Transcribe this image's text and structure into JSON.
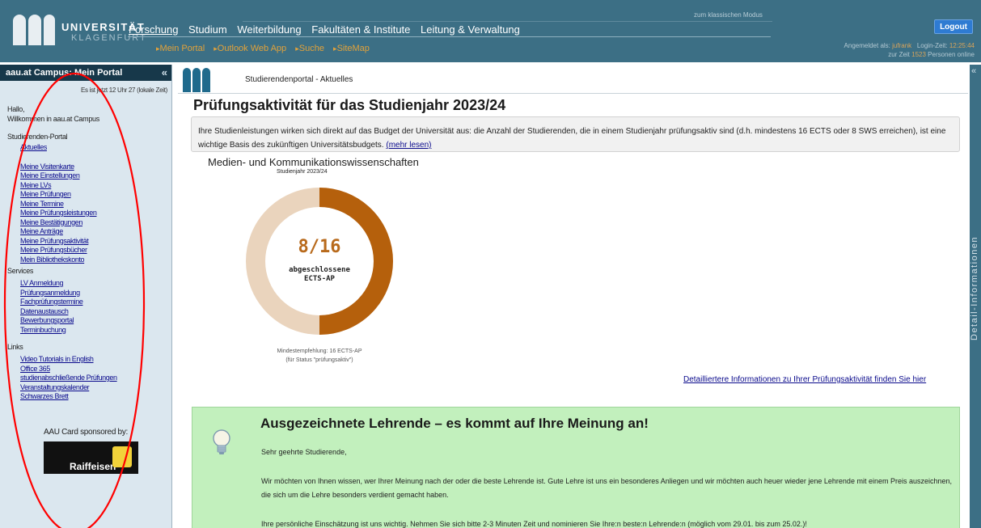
{
  "header": {
    "logo_university": "UNIVERSITÄT",
    "logo_city": "KLAGENFURT",
    "main_nav": [
      "Forschung",
      "Studium",
      "Weiterbildung",
      "Fakultäten & Institute",
      "Leitung & Verwaltung"
    ],
    "sub_nav": [
      "Mein Portal",
      "Outlook Web App",
      "Suche",
      "SiteMap"
    ],
    "classic_mode": "zum klassischen Modus",
    "logout": "Logout",
    "login_label": "Angemeldet als:",
    "login_user": "jufrank",
    "login_time_label": "Login-Zeit:",
    "login_time": "12:25:44",
    "online_prefix": "zur Zeit",
    "online_count": "1523",
    "online_suffix": "Personen online"
  },
  "sidebar": {
    "title": "aau.at Campus: Mein Portal",
    "time": "Es ist jetzt 12 Uhr 27 (lokale Zeit)",
    "greeting": "Hallo,",
    "welcome": "Willkommen in aau.at Campus",
    "sections": [
      {
        "title": "Studierenden-Portal",
        "items": [
          "Aktuelles"
        ]
      },
      {
        "title": "",
        "items": [
          "Meine Visitenkarte",
          "Meine Einstellungen",
          "Meine LVs",
          "Meine Prüfungen",
          "Meine Termine",
          "Meine Prüfungsleistungen",
          "Meine Bestätigungen",
          "Meine Anträge",
          "Meine Prüfungsaktivität",
          "Meine Prüfungsbücher",
          "Mein Bibliothekskonto"
        ]
      },
      {
        "title": "Services",
        "items": [
          "LV Anmeldung",
          "Prüfungsanmeldung",
          "Fachprüfungstermine",
          "Datenaustausch",
          "Bewerbungsportal",
          "Terminbuchung"
        ]
      },
      {
        "title": "Links",
        "items": [
          "Video Tutorials in English",
          "Office 365",
          "studienabschließende Prüfungen",
          "Veranstaltungskalender",
          "Schwarzes Brett"
        ]
      }
    ],
    "sponsor": "AAU Card sponsored by:",
    "sponsor_logo_text": "Raiffeisen"
  },
  "main": {
    "breadcrumb": "Studierendenportal - Aktuelles",
    "title": "Prüfungsaktivität für das Studienjahr 2023/24",
    "info_text": "Ihre Studienleistungen wirken sich direkt auf das Budget der Universität aus: die Anzahl der Studierenden, die in einem Studienjahr prüfungsaktiv sind (d.h. mindestens 16 ECTS oder 8 SWS erreichen), ist eine wichtige Basis des zukünftigen Universitätsbudgets.",
    "info_link": "(mehr lesen)",
    "study_program": "Medien- und Kommunikationswissenschaften",
    "detail_link": "Detailliertere Informationen zu Ihrer Prüfungsaktivität finden Sie hier"
  },
  "chart_data": {
    "type": "pie",
    "title": "Studienjahr 2023/24",
    "center_value": "8/16",
    "center_caption_1": "abgeschlossene",
    "center_caption_2": "ECTS-AP",
    "achieved": 8,
    "target": 16,
    "colors": {
      "achieved": "#b5600c",
      "remaining": "#ead4bd"
    },
    "note_1": "Mindestempfehlung: 16 ECTS-AP",
    "note_2": "(für Status \"prüfungsaktiv\")"
  },
  "lehrende": {
    "title": "Ausgezeichnete Lehrende – es kommt auf Ihre Meinung an!",
    "salutation": "Sehr geehrte Studierende,",
    "paragraph_1": "Wir möchten von Ihnen wissen, wer Ihrer Meinung nach der oder die beste Lehrende ist. Gute Lehre ist uns ein besonderes Anliegen und wir möchten auch heuer wieder jene Lehrende mit einem Preis auszeichnen, die sich um die Lehre besonders verdient gemacht haben.",
    "paragraph_2": "Ihre persönliche Einschätzung ist uns wichtig. Nehmen Sie sich bitte 2-3 Minuten Zeit und nominieren Sie Ihre:n beste:n Lehrende:n (möglich vom 29.01. bis zum 25.02.)!"
  },
  "right_rail": {
    "label": "Detail-Informationen",
    "collapse": "«"
  },
  "annotation": {
    "color": "#ff0000"
  }
}
